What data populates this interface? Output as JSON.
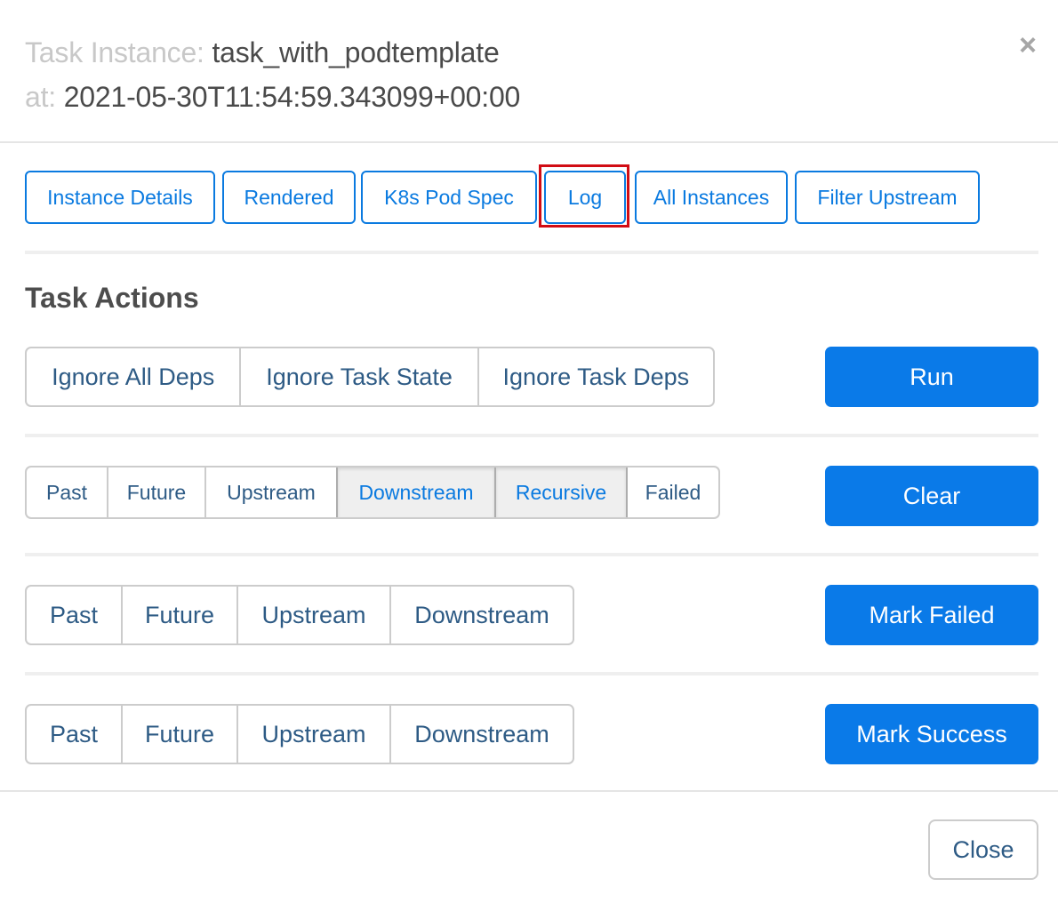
{
  "header": {
    "task_label": "Task Instance:",
    "task_id": "task_with_podtemplate",
    "at_label": "at:",
    "execution_date": "2021-05-30T11:54:59.343099+00:00",
    "close_icon": "×"
  },
  "links": [
    {
      "label": "Instance Details"
    },
    {
      "label": "Rendered"
    },
    {
      "label": "K8s Pod Spec"
    },
    {
      "label": "Log",
      "highlighted": true
    },
    {
      "label": "All Instances"
    },
    {
      "label": "Filter Upstream"
    }
  ],
  "task_actions": {
    "title": "Task Actions",
    "run": {
      "options": [
        {
          "label": "Ignore All Deps",
          "active": false
        },
        {
          "label": "Ignore Task State",
          "active": false
        },
        {
          "label": "Ignore Task Deps",
          "active": false
        }
      ],
      "button": "Run"
    },
    "clear": {
      "options": [
        {
          "label": "Past",
          "active": false
        },
        {
          "label": "Future",
          "active": false
        },
        {
          "label": "Upstream",
          "active": false
        },
        {
          "label": "Downstream",
          "active": true
        },
        {
          "label": "Recursive",
          "active": true
        },
        {
          "label": "Failed",
          "active": false
        }
      ],
      "button": "Clear"
    },
    "mark_failed": {
      "options": [
        {
          "label": "Past",
          "active": false
        },
        {
          "label": "Future",
          "active": false
        },
        {
          "label": "Upstream",
          "active": false
        },
        {
          "label": "Downstream",
          "active": false
        }
      ],
      "button": "Mark Failed"
    },
    "mark_success": {
      "options": [
        {
          "label": "Past",
          "active": false
        },
        {
          "label": "Future",
          "active": false
        },
        {
          "label": "Upstream",
          "active": false
        },
        {
          "label": "Downstream",
          "active": false
        }
      ],
      "button": "Mark Success"
    }
  },
  "footer": {
    "close_label": "Close"
  },
  "colors": {
    "primary": "#0a7ae8",
    "link": "#0a7ae0",
    "highlight": "#d10c14",
    "segment_text": "#2e5b85"
  }
}
